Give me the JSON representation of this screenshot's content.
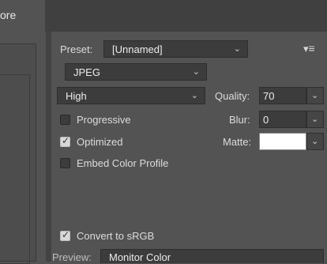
{
  "tab": {
    "label": "ore"
  },
  "preset": {
    "label": "Preset:",
    "value": "[Unnamed]"
  },
  "format": {
    "value": "JPEG"
  },
  "quality_level": {
    "value": "High"
  },
  "quality": {
    "label": "Quality:",
    "value": "70"
  },
  "blur": {
    "label": "Blur:",
    "value": "0"
  },
  "matte": {
    "label": "Matte:",
    "color": "#ffffff"
  },
  "options": {
    "progressive": {
      "label": "Progressive",
      "checked": false
    },
    "optimized": {
      "label": "Optimized",
      "checked": true
    },
    "embed_profile": {
      "label": "Embed Color Profile",
      "checked": false
    },
    "convert_srgb": {
      "label": "Convert to sRGB",
      "checked": true
    }
  },
  "preview": {
    "label": "Preview:",
    "value": "Monitor Color"
  },
  "icons": {
    "chevron": "⌄",
    "menu": "≡"
  }
}
